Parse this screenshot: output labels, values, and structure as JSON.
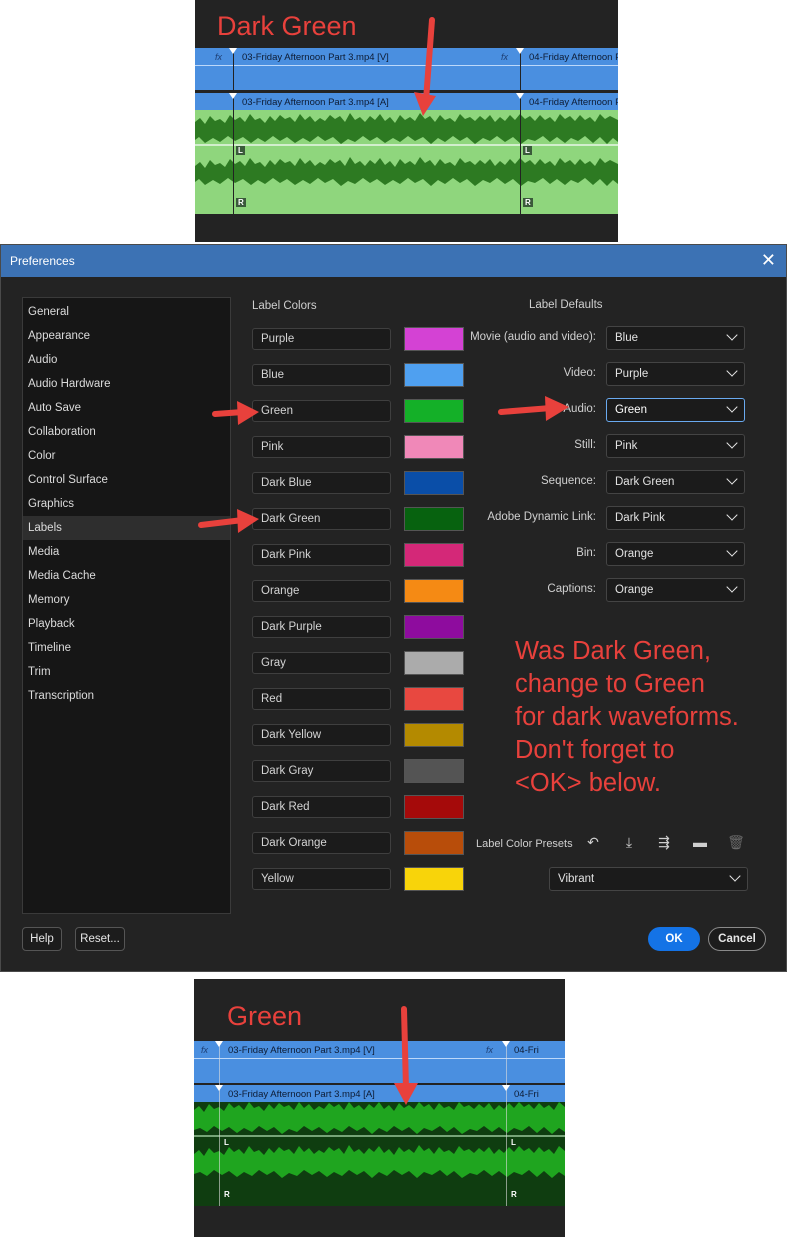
{
  "top_panel": {
    "title": "Dark Green",
    "video_clip_1": "03-Friday Afternoon Part 3.mp4 [V]",
    "video_clip_2": "04-Friday Afternoon P",
    "audio_clip_1": "03-Friday Afternoon Part 3.mp4 [A]",
    "audio_clip_2": "04-Friday Afternoon P",
    "fx": "fx",
    "left_channel": "L",
    "right_channel": "R",
    "waveform_color": "#2d7a22",
    "track_color": "#8fd67d"
  },
  "dialog": {
    "title": "Preferences",
    "close_icon": "close-icon",
    "sidebar": [
      {
        "label": "General"
      },
      {
        "label": "Appearance"
      },
      {
        "label": "Audio"
      },
      {
        "label": "Audio Hardware"
      },
      {
        "label": "Auto Save"
      },
      {
        "label": "Collaboration"
      },
      {
        "label": "Color"
      },
      {
        "label": "Control Surface"
      },
      {
        "label": "Graphics"
      },
      {
        "label": "Labels"
      },
      {
        "label": "Media"
      },
      {
        "label": "Media Cache"
      },
      {
        "label": "Memory"
      },
      {
        "label": "Playback"
      },
      {
        "label": "Timeline"
      },
      {
        "label": "Trim"
      },
      {
        "label": "Transcription"
      }
    ],
    "selected_sidebar": "Labels",
    "label_colors_header": "Label Colors",
    "label_colors": [
      {
        "name": "Purple",
        "color": "#d442d4"
      },
      {
        "name": "Blue",
        "color": "#4fa0f0"
      },
      {
        "name": "Green",
        "color": "#14b028"
      },
      {
        "name": "Pink",
        "color": "#f088b8"
      },
      {
        "name": "Dark Blue",
        "color": "#0a4ea8"
      },
      {
        "name": "Dark Green",
        "color": "#07620f"
      },
      {
        "name": "Dark Pink",
        "color": "#d42878"
      },
      {
        "name": "Orange",
        "color": "#f58a14"
      },
      {
        "name": "Dark Purple",
        "color": "#8e0c9e"
      },
      {
        "name": "Gray",
        "color": "#ababab"
      },
      {
        "name": "Red",
        "color": "#e84840"
      },
      {
        "name": "Dark Yellow",
        "color": "#b48a00"
      },
      {
        "name": "Dark Gray",
        "color": "#545454"
      },
      {
        "name": "Dark Red",
        "color": "#a50a0a"
      },
      {
        "name": "Dark Orange",
        "color": "#b84d0a"
      },
      {
        "name": "Yellow",
        "color": "#f8d40a"
      }
    ],
    "label_defaults_header": "Label Defaults",
    "label_defaults": [
      {
        "label": "Movie (audio and video):",
        "value": "Blue"
      },
      {
        "label": "Video:",
        "value": "Purple"
      },
      {
        "label": "Audio:",
        "value": "Green"
      },
      {
        "label": "Still:",
        "value": "Pink"
      },
      {
        "label": "Sequence:",
        "value": "Dark Green"
      },
      {
        "label": "Adobe Dynamic Link:",
        "value": "Dark Pink"
      },
      {
        "label": "Bin:",
        "value": "Orange"
      },
      {
        "label": "Captions:",
        "value": "Orange"
      }
    ],
    "note": "Was Dark Green,\nchange to Green\nfor dark waveforms.\nDon't forget to\n<OK> below.",
    "presets_label": "Label Color Presets",
    "preset_value": "Vibrant",
    "help": "Help",
    "reset": "Reset...",
    "ok": "OK",
    "cancel": "Cancel",
    "accent": "#1473e6",
    "annotation_color": "#e8413c"
  },
  "bottom_panel": {
    "title": "Green",
    "video_clip_1": "03-Friday Afternoon Part 3.mp4 [V]",
    "video_clip_2": "04-Fri",
    "audio_clip_1": "03-Friday Afternoon Part 3.mp4 [A]",
    "audio_clip_2": "04-Fri",
    "fx": "fx",
    "left_channel": "L",
    "right_channel": "R",
    "waveform_color": "#1fa51f",
    "track_color": "#0f3d10"
  }
}
